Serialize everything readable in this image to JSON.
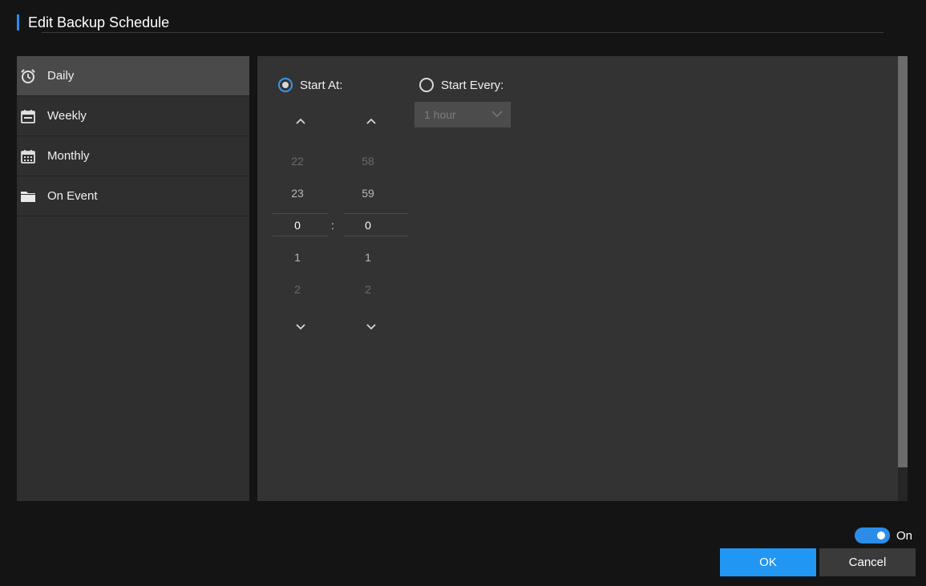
{
  "dialog": {
    "title": "Edit Backup Schedule"
  },
  "sidebar": {
    "items": [
      {
        "label": "Daily",
        "icon": "alarm-clock-icon",
        "active": true
      },
      {
        "label": "Weekly",
        "icon": "calendar-week-icon",
        "active": false
      },
      {
        "label": "Monthly",
        "icon": "calendar-month-icon",
        "active": false
      },
      {
        "label": "On Event",
        "icon": "folder-icon",
        "active": false
      }
    ]
  },
  "schedule": {
    "start_at": {
      "label": "Start At:",
      "selected": true
    },
    "start_every": {
      "label": "Start Every:",
      "selected": false
    },
    "interval": {
      "value": "1 hour",
      "disabled": true
    },
    "time_separator": ":",
    "hours": {
      "values": [
        "22",
        "23",
        "0",
        "1",
        "2"
      ],
      "selected": "0"
    },
    "minutes": {
      "values": [
        "58",
        "59",
        "0",
        "1",
        "2"
      ],
      "selected": "0"
    }
  },
  "footer": {
    "toggle": {
      "label": "On",
      "state": true
    },
    "ok_label": "OK",
    "cancel_label": "Cancel"
  },
  "colors": {
    "accent": "#2196f3",
    "background": "#141414",
    "panel": "#333333",
    "sidebar": "#2f2f2f",
    "sidebar_active": "#4a4a4a"
  }
}
